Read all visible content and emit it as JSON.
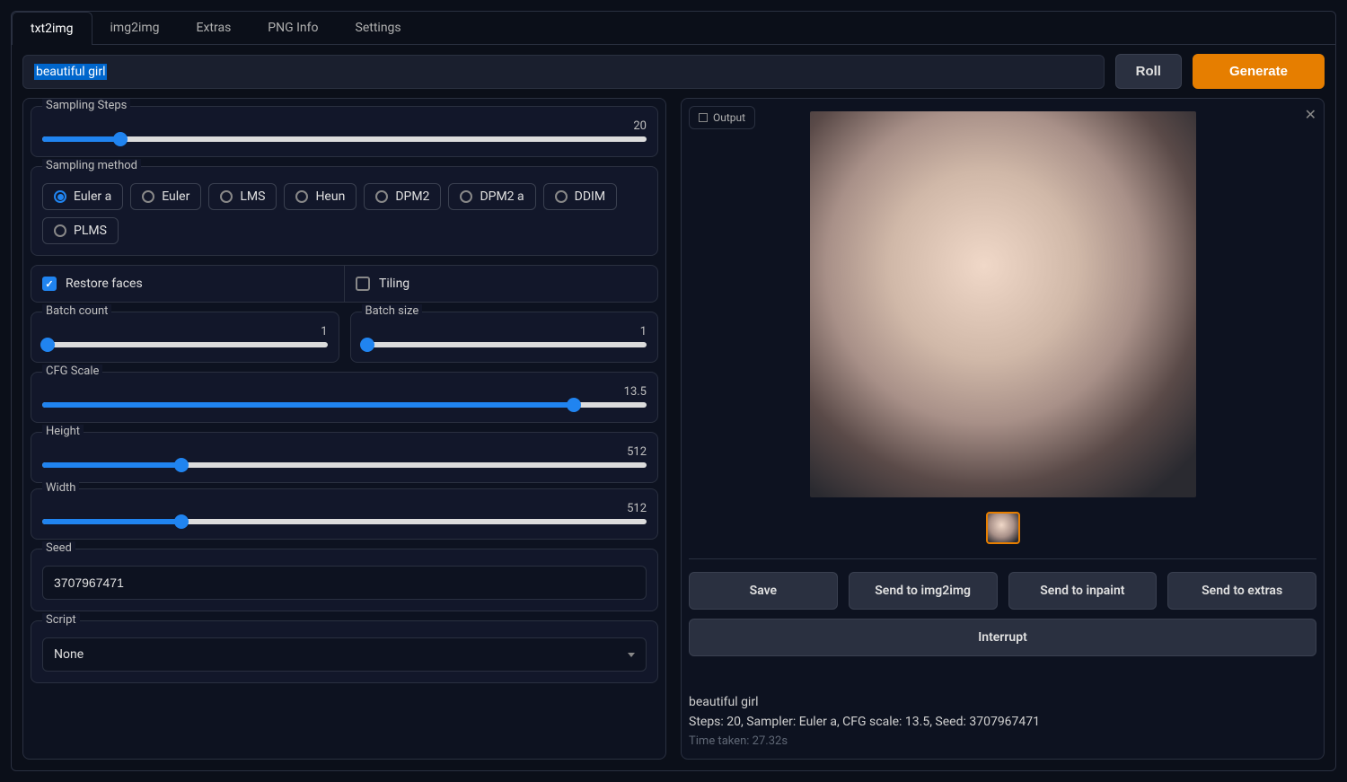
{
  "tabs": [
    "txt2img",
    "img2img",
    "Extras",
    "PNG Info",
    "Settings"
  ],
  "active_tab_index": 0,
  "prompt": "beautiful girl",
  "buttons": {
    "roll": "Roll",
    "generate": "Generate"
  },
  "sampling_steps": {
    "label": "Sampling Steps",
    "value": 20,
    "percent": 13
  },
  "sampling_method": {
    "label": "Sampling method",
    "options": [
      "Euler a",
      "Euler",
      "LMS",
      "Heun",
      "DPM2",
      "DPM2 a",
      "DDIM",
      "PLMS"
    ],
    "selected_index": 0
  },
  "restore_faces": {
    "label": "Restore faces",
    "checked": true
  },
  "tiling": {
    "label": "Tiling",
    "checked": false
  },
  "batch_count": {
    "label": "Batch count",
    "value": 1,
    "percent": 0
  },
  "batch_size": {
    "label": "Batch size",
    "value": 1,
    "percent": 0
  },
  "cfg_scale": {
    "label": "CFG Scale",
    "value": 13.5,
    "percent": 88
  },
  "height": {
    "label": "Height",
    "value": 512,
    "percent": 23
  },
  "width": {
    "label": "Width",
    "value": 512,
    "percent": 23
  },
  "seed": {
    "label": "Seed",
    "value": "3707967471"
  },
  "script": {
    "label": "Script",
    "selected": "None"
  },
  "output": {
    "tab_label": "Output",
    "actions": {
      "save": "Save",
      "send_img2img": "Send to img2img",
      "send_inpaint": "Send to inpaint",
      "send_extras": "Send to extras",
      "interrupt": "Interrupt"
    },
    "info_prompt": "beautiful girl",
    "info_params": "Steps: 20, Sampler: Euler a, CFG scale: 13.5, Seed: 3707967471",
    "time_taken": "Time taken: 27.32s"
  }
}
